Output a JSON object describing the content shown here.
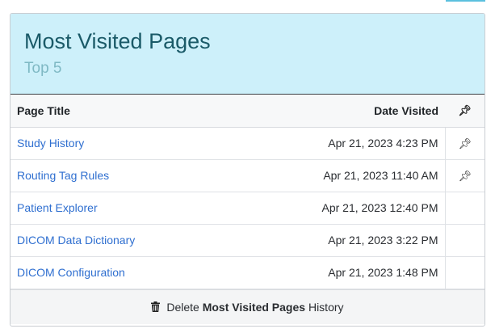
{
  "header": {
    "title": "Most Visited Pages",
    "subtitle": "Top 5"
  },
  "table": {
    "columns": [
      "Page Title",
      "Date Visited"
    ],
    "pin_header_icon": "pin-icon",
    "rows": [
      {
        "title": "Study History",
        "date": "Apr 21, 2023 4:23 PM",
        "pinned": true
      },
      {
        "title": "Routing Tag Rules",
        "date": "Apr 21, 2023 11:40 AM",
        "pinned": true
      },
      {
        "title": "Patient Explorer",
        "date": "Apr 21, 2023 12:40 PM",
        "pinned": false
      },
      {
        "title": "DICOM Data Dictionary",
        "date": "Apr 21, 2023 3:22 PM",
        "pinned": false
      },
      {
        "title": "DICOM Configuration",
        "date": "Apr 21, 2023 1:48 PM",
        "pinned": false
      }
    ]
  },
  "footer": {
    "delete_prefix": "Delete",
    "delete_bold": "Most Visited Pages",
    "delete_suffix": "History",
    "icon": "trash-icon"
  },
  "colors": {
    "header_bg": "#cdf0fa",
    "title": "#1a5a68",
    "subtitle": "#7fb9c4",
    "link": "#2f6fd0",
    "accent": "#5bc0de"
  }
}
